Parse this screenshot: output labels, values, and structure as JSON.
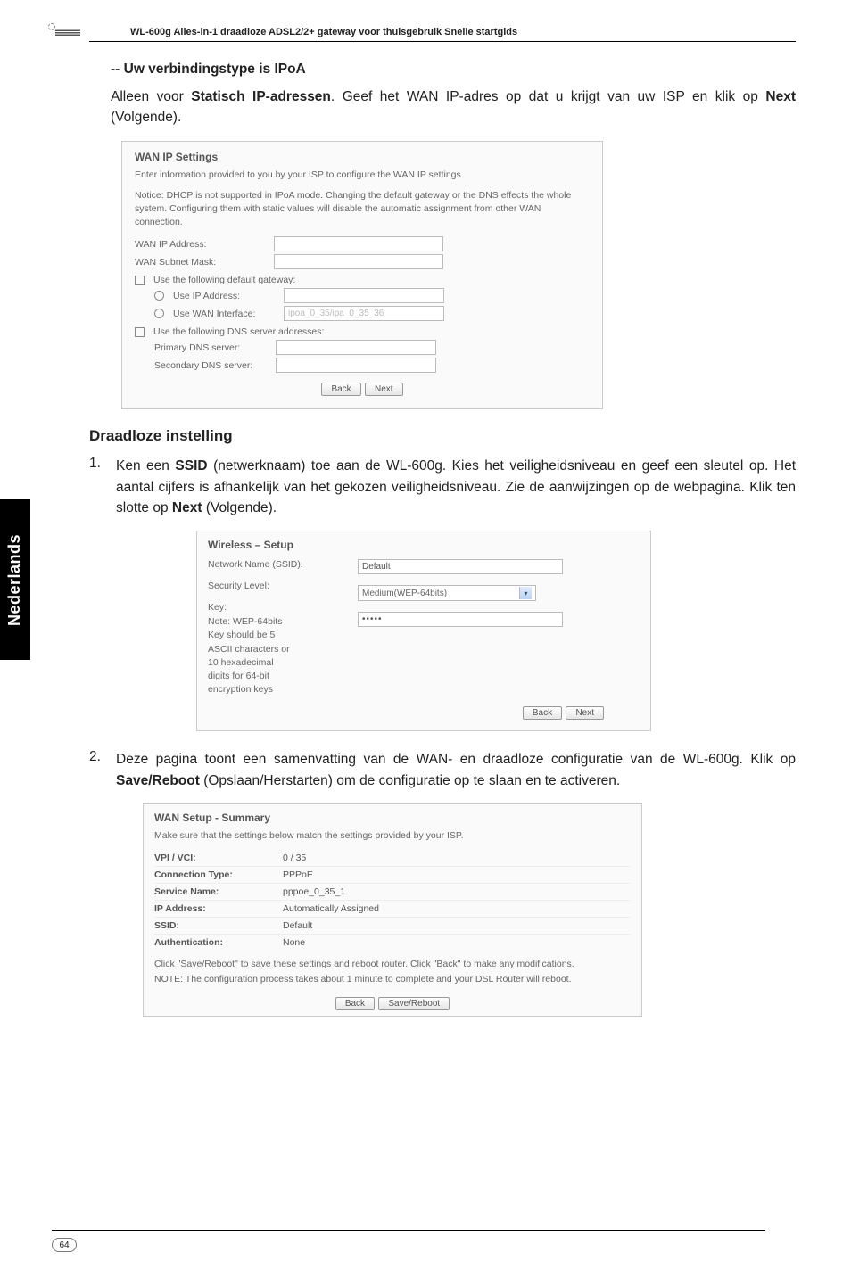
{
  "header": {
    "product_line": "WL-600g Alles-in-1 draadloze ADSL2/2+ gateway voor thuisgebruik Snelle startgids"
  },
  "side_tab": "Nederlands",
  "page_number": "64",
  "section_ipoa": {
    "heading": "-- Uw verbindingstype is IPoA",
    "body_prefix": "Alleen voor ",
    "body_strong1": "Statisch IP-adressen",
    "body_mid": ". Geef het WAN IP-adres op dat u krijgt van uw ISP en klik op ",
    "body_strong2": "Next",
    "body_suffix": " (Volgende)."
  },
  "screenshot1": {
    "title": "WAN IP Settings",
    "intro": "Enter information provided to you by your ISP to configure the WAN IP settings.",
    "notice": "Notice: DHCP is not supported in IPoA mode. Changing the default gateway or the DNS effects the whole system. Configuring them with static values will disable the automatic assignment from other WAN connection.",
    "wan_ip_label": "WAN IP Address:",
    "wan_subnet_label": "WAN Subnet Mask:",
    "chk_default_gw": "Use the following default gateway:",
    "use_ip_address": "Use IP Address:",
    "use_wan_interface": "Use WAN Interface:",
    "use_wan_iface_val": "ipoa_0_35/ipa_0_35_36",
    "chk_dns": "Use the following DNS server addresses:",
    "primary_dns": "Primary DNS server:",
    "secondary_dns": "Secondary DNS server:",
    "btn_back": "Back",
    "btn_next": "Next"
  },
  "section_wireless": {
    "subhead": "Draadloze instelling",
    "li1_num": "1.",
    "li1_prefix": "Ken een ",
    "li1_strong1": "SSID",
    "li1_mid1": " (netwerknaam) toe aan de WL-600g. Kies het veiligheidsniveau en geef een sleutel op. Het aantal cijfers is afhankelijk van het gekozen veiligheidsniveau. Zie de aanwijzingen op de webpagina. Klik ten slotte op ",
    "li1_strong2": "Next",
    "li1_suffix": " (Volgende)."
  },
  "screenshot2": {
    "title": "Wireless – Setup",
    "ssid_label": "Network Name (SSID):",
    "ssid_value": "Default",
    "security_label": "Security Level:",
    "security_value": "Medium(WEP-64bits)",
    "key_label": "Key:",
    "key_value": "•••••",
    "note": "Note: WEP-64bits Key should be 5 ASCII characters or 10 hexadecimal digits for 64-bit encryption keys",
    "btn_back": "Back",
    "btn_next": "Next"
  },
  "section_summary": {
    "li2_num": "2.",
    "li2_prefix": "Deze pagina toont een samenvatting van de WAN- en draadloze configuratie van de WL-600g. Klik op ",
    "li2_strong": "Save/Reboot",
    "li2_suffix": " (Opslaan/Herstarten) om de configuratie op te slaan en te activeren."
  },
  "screenshot3": {
    "title": "WAN Setup - Summary",
    "intro": "Make sure that the settings below match the settings provided by your ISP.",
    "rows": {
      "vpi_vci_label": "VPI / VCI:",
      "vpi_vci_value": "0 / 35",
      "conn_type_label": "Connection Type:",
      "conn_type_value": "PPPoE",
      "service_name_label": "Service Name:",
      "service_name_value": "pppoe_0_35_1",
      "ip_addr_label": "IP Address:",
      "ip_addr_value": "Automatically Assigned",
      "ssid_label": "SSID:",
      "ssid_value": "Default",
      "auth_label": "Authentication:",
      "auth_value": "None"
    },
    "footer_note1": "Click \"Save/Reboot\" to save these settings and reboot router. Click \"Back\" to make any modifications.",
    "footer_note2": "NOTE: The configuration process takes about 1 minute to complete and your DSL Router will reboot.",
    "btn_back": "Back",
    "btn_save": "Save/Reboot"
  }
}
